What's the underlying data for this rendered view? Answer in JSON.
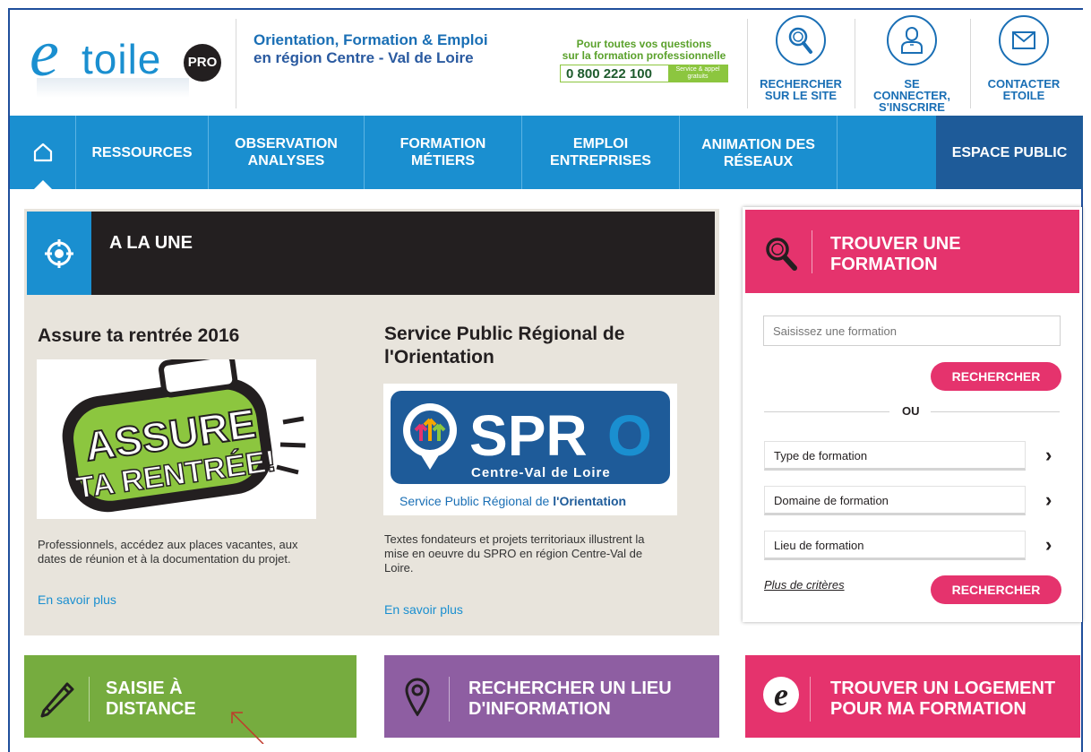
{
  "header": {
    "tagline_line1": "Orientation, Formation & Emploi",
    "tagline_line2": "en région Centre - Val de Loire",
    "phone_question_1": "Pour toutes vos questions",
    "phone_question_2": "sur la formation professionnelle",
    "phone_number": "0 800 222 100",
    "phone_free_1": "Service & appel",
    "phone_free_2": "gratuits",
    "actions": [
      {
        "label1": "RECHERCHER",
        "label2": "SUR LE SITE",
        "icon": "search-icon"
      },
      {
        "label1": "SE CONNECTER,",
        "label2": "S'INSCRIRE",
        "icon": "user-icon"
      },
      {
        "label1": "CONTACTER",
        "label2": "ETOILE",
        "icon": "mail-icon"
      }
    ]
  },
  "logo": {
    "e": "e",
    "toile": "toile",
    "pro": "PRO"
  },
  "nav": {
    "home_icon": "home-icon",
    "items": [
      {
        "l1": "RESSOURCES",
        "l2": ""
      },
      {
        "l1": "OBSERVATION",
        "l2": "ANALYSES"
      },
      {
        "l1": "FORMATION",
        "l2": "MÉTIERS"
      },
      {
        "l1": "EMPLOI",
        "l2": "ENTREPRISES"
      },
      {
        "l1": "ANIMATION DES",
        "l2": "RÉSEAUX"
      }
    ],
    "public": "ESPACE PUBLIC"
  },
  "une": {
    "title": "A LA UNE",
    "articles": [
      {
        "title": "Assure ta rentrée 2016",
        "text_1": "Professionnels, accédez aux places vacantes, aux",
        "text_2": "dates de réunion et à la documentation du projet.",
        "more": "En savoir plus",
        "img_line1": "ASSURE",
        "img_line2": "TA RENTRÉE!"
      },
      {
        "title_1": "Service Public Régional de",
        "title_2": "l'Orientation",
        "text_1": "Textes fondateurs et projets territoriaux illustrent la",
        "text_2": "mise en oeuvre du SPRO en région Centre-Val de",
        "text_3": "Loire.",
        "more": "En savoir plus",
        "img_big": "SPRO",
        "img_region": "Centre-Val de Loire",
        "img_caption_a": "Service Public Régional de ",
        "img_caption_b": "l'Orientation"
      }
    ]
  },
  "search": {
    "title_1": "TROUVER UNE",
    "title_2": "FORMATION",
    "placeholder": "Saisissez une formation",
    "button": "RECHERCHER",
    "or": "OU",
    "selects": [
      "Type de formation",
      "Domaine de formation",
      "Lieu de formation"
    ],
    "more_criteria": "Plus de critères",
    "button2": "RECHERCHER"
  },
  "tiles": [
    {
      "l1": "SAISIE À",
      "l2": "DISTANCE",
      "color": "#76ac3f"
    },
    {
      "l1": "RECHERCHER UN LIEU",
      "l2": "D'INFORMATION",
      "color": "#8e5ea2"
    },
    {
      "l1": "TROUVER UN LOGEMENT",
      "l2": "POUR MA FORMATION",
      "color": "#e5336d"
    }
  ],
  "colors": {
    "primary": "#1a8fd0",
    "dark_blue": "#1e5b99",
    "pink": "#e5336d",
    "green": "#76ac3f",
    "purple": "#8e5ea2",
    "dark": "#231f20"
  }
}
